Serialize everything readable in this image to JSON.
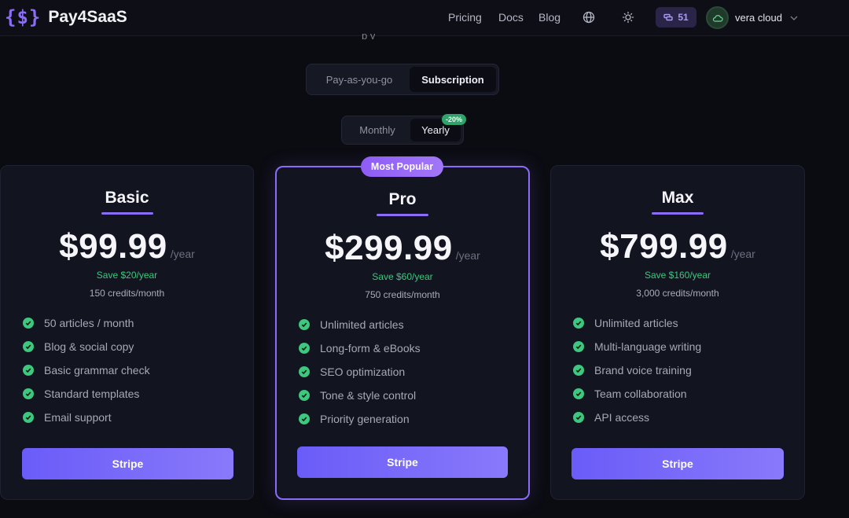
{
  "header": {
    "brand_mark": "{$}",
    "brand_name": "Pay4SaaS",
    "nav": {
      "pricing": "Pricing",
      "docs": "Docs",
      "blog": "Blog"
    },
    "credits_count": "51",
    "user_name": "vera cloud"
  },
  "partial_text": "p             y",
  "billing_mode": {
    "payg": "Pay-as-you-go",
    "subscription": "Subscription",
    "selected": "Subscription"
  },
  "billing_period": {
    "monthly": "Monthly",
    "yearly": "Yearly",
    "yearly_badge": "-20%",
    "selected": "Yearly"
  },
  "featured_badge": "Most Popular",
  "plans": [
    {
      "name": "Basic",
      "price": "$99.99",
      "per": "/year",
      "save": "Save $20/year",
      "credits": "150 credits/month",
      "features": [
        "50 articles / month",
        "Blog & social copy",
        "Basic grammar check",
        "Standard templates",
        "Email support"
      ],
      "button": "Stripe"
    },
    {
      "name": "Pro",
      "price": "$299.99",
      "per": "/year",
      "save": "Save $60/year",
      "credits": "750 credits/month",
      "features": [
        "Unlimited articles",
        "Long-form & eBooks",
        "SEO optimization",
        "Tone & style control",
        "Priority generation"
      ],
      "button": "Stripe"
    },
    {
      "name": "Max",
      "price": "$799.99",
      "per": "/year",
      "save": "Save $160/year",
      "credits": "3,000 credits/month",
      "features": [
        "Unlimited articles",
        "Multi-language writing",
        "Brand voice training",
        "Team collaboration",
        "API access"
      ],
      "button": "Stripe"
    }
  ],
  "colors": {
    "accent": "#8b6cf6",
    "success": "#3ec77e",
    "background": "#0b0c12",
    "card": "#121420"
  },
  "icons": {
    "language": "globe-icon",
    "theme": "sun-icon",
    "credits": "coins-icon",
    "avatar": "cloud-icon",
    "menu": "chevron-down-icon",
    "feature": "check-circle-icon"
  }
}
